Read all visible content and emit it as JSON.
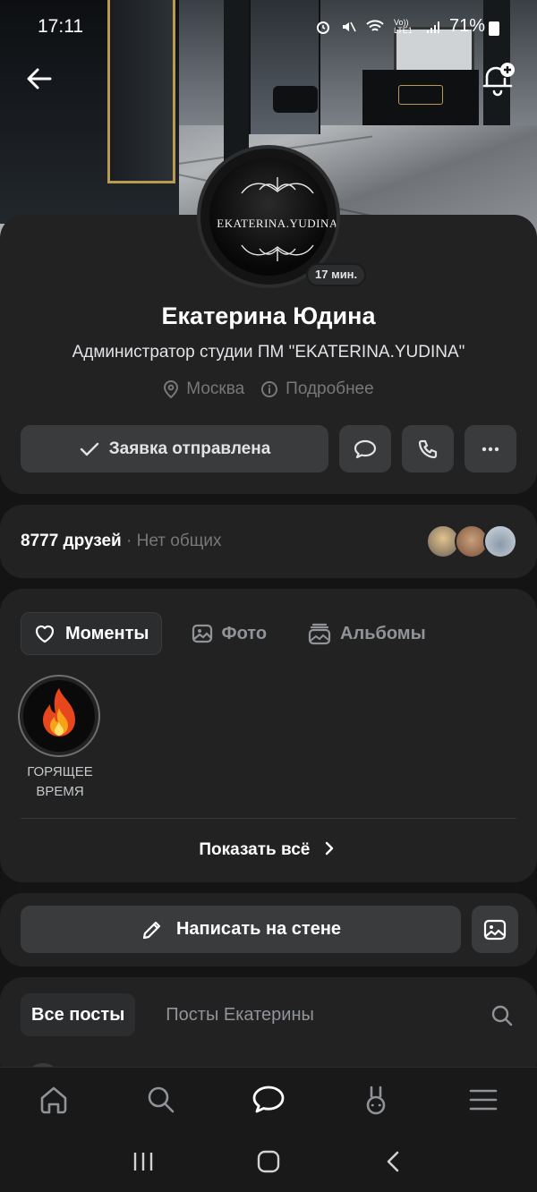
{
  "status_bar": {
    "time": "17:11",
    "network": "Vo)) LTE1",
    "battery": "71%"
  },
  "profile": {
    "avatar_logo_text": "EKATERINA.YUDINA",
    "last_seen_badge": "17 мин.",
    "name": "Екатерина Юдина",
    "job": "Администратор студии ПМ \"EKATERINA.YUDINA\"",
    "city": "Москва",
    "details_link": "Подробнее",
    "request_button": "Заявка отправлена"
  },
  "friends": {
    "count_label": "8777 друзей",
    "mutual_label": " · Нет общих"
  },
  "moments_section": {
    "tabs": [
      "Моменты",
      "Фото",
      "Альбомы"
    ],
    "story_label": "ГОРЯЩЕЕ ВРЕМЯ",
    "show_all": "Показать всё"
  },
  "wall": {
    "write_button": "Написать на стене"
  },
  "posts": {
    "tabs": [
      "Все посты",
      "Посты Екатерины"
    ]
  },
  "colors": {
    "background": "#141414",
    "card": "#222222",
    "button": "#3a3b3c",
    "secondary_text": "#76787a",
    "accent_gold": "#b89a52"
  }
}
